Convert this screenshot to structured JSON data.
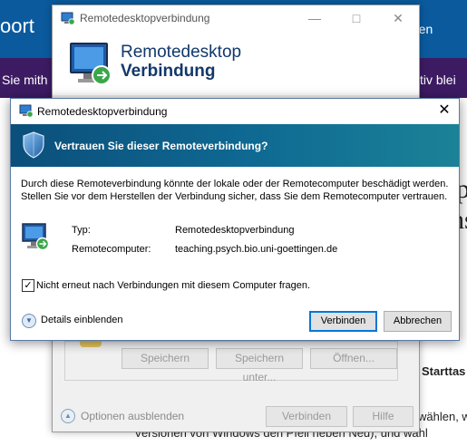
{
  "background_page": {
    "header_left": "oort",
    "header_right": "ren",
    "purple_left": "Sie mith",
    "purple_right": "ktiv blei",
    "side_glyph_1": "p",
    "side_glyph_2": "ns",
    "starttaste": "Starttas",
    "line_waehlen": "wählen, w",
    "line_bottom": "Versionen von Windows den Pfeil neben Neu), und wähl"
  },
  "rdp_window": {
    "title": "Remotedesktopverbindung",
    "banner_line1": "Remotedesktop",
    "banner_line2": "Verbindung",
    "buttons": {
      "save": "Speichern",
      "save_as": "Speichern unter...",
      "open": "Öffnen..."
    },
    "options_label": "Optionen ausblenden",
    "connect": "Verbinden",
    "help": "Hilfe"
  },
  "dialog": {
    "title": "Remotedesktopverbindung",
    "header": "Vertrauen Sie dieser Remoteverbindung?",
    "message_line1": "Durch diese Remoteverbindung könnte der lokale oder der Remotecomputer beschädigt werden.",
    "message_line2": "Stellen Sie vor dem Herstellen der Verbindung sicher, dass Sie dem Remotecomputer vertrauen.",
    "type_label": "Typ:",
    "type_value": "Remotedesktopverbindung",
    "computer_label": "Remotecomputer:",
    "computer_value": "teaching.psych.bio.uni-goettingen.de",
    "checkbox_label": "Nicht erneut nach Verbindungen mit diesem Computer fragen.",
    "checkbox_checked": true,
    "details_label": "Details einblenden",
    "connect_button": "Verbinden",
    "cancel_button": "Abbrechen"
  },
  "icons": {
    "shield": "shield-icon",
    "remote_desktop": "remote-desktop-icon",
    "close": "close-icon",
    "minimize": "minimize-icon",
    "maximize": "maximize-icon",
    "chevron_down": "chevron-down-icon",
    "chevron_up": "chevron-up-icon"
  },
  "colors": {
    "header_blue": "#0b5a9e",
    "purple_band": "#3d1b63",
    "dialog_band": "#0f6a93",
    "primary_button_border": "#0078d7"
  }
}
